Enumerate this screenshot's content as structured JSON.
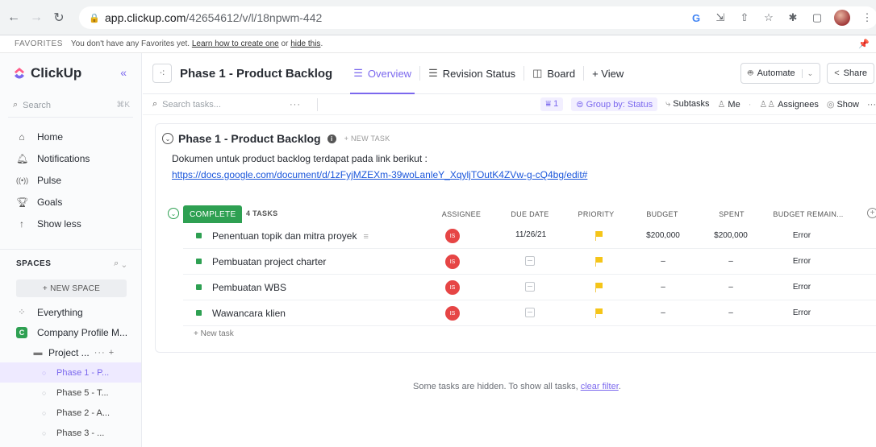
{
  "browser": {
    "url_host": "app.clickup.com",
    "url_path": "/42654612/v/l/18npwm-442"
  },
  "favorites": {
    "title": "FAVORITES",
    "message": "You don't have any Favorites yet.",
    "learn_link": "Learn how to create one",
    "or": "or",
    "hide_link": "hide this",
    "period": "."
  },
  "sidebar": {
    "brand": "ClickUp",
    "search_placeholder": "Search",
    "search_shortcut": "⌘K",
    "menu": [
      {
        "label": "Home"
      },
      {
        "label": "Notifications"
      },
      {
        "label": "Pulse"
      },
      {
        "label": "Goals"
      },
      {
        "label": "Show less"
      }
    ],
    "spaces_title": "SPACES",
    "new_space": "+ NEW SPACE",
    "everything": "Everything",
    "space_badge": "C",
    "space_name": "Company Profile M...",
    "folder_name": "Project ...",
    "lists": [
      {
        "label": "Phase 1 - P..."
      },
      {
        "label": "Phase 5 - T..."
      },
      {
        "label": "Phase 2 - A..."
      },
      {
        "label": "Phase 3 - ..."
      }
    ]
  },
  "header": {
    "title": "Phase 1 - Product Backlog",
    "tabs": [
      {
        "label": "Overview"
      },
      {
        "label": "Revision Status"
      },
      {
        "label": "Board"
      },
      {
        "label": "+ View"
      }
    ],
    "automate": "Automate",
    "share": "Share"
  },
  "toolbar": {
    "search_placeholder": "Search tasks...",
    "filter_count": "1",
    "group_by": "Group by: Status",
    "subtasks": "Subtasks",
    "me": "Me",
    "assignees": "Assignees",
    "show": "Show"
  },
  "list": {
    "title": "Phase 1 - Product Backlog",
    "new_task_top": "+ NEW TASK",
    "description": "Dokumen untuk product backlog terdapat pada link berikut :",
    "link": "https://docs.google.com/document/d/1zFyjMZEXm-39woLanleY_XqyljTOutK4ZVw-g-cQ4bg/edit#",
    "status": "COMPLETE",
    "task_count": "4 TASKS",
    "columns": {
      "assignee": "ASSIGNEE",
      "due_date": "DUE DATE",
      "priority": "PRIORITY",
      "budget": "BUDGET",
      "spent": "SPENT",
      "budget_remaining": "BUDGET REMAIN..."
    },
    "tasks": [
      {
        "name": "Penentuan topik dan mitra proyek",
        "assignee": "IS",
        "due": "11/26/21",
        "budget": "$200,000",
        "spent": "$200,000",
        "remaining": "Error"
      },
      {
        "name": "Pembuatan project charter",
        "assignee": "IS",
        "due": "",
        "budget": "–",
        "spent": "–",
        "remaining": "Error"
      },
      {
        "name": "Pembuatan WBS",
        "assignee": "IS",
        "due": "",
        "budget": "–",
        "spent": "–",
        "remaining": "Error"
      },
      {
        "name": "Wawancara klien",
        "assignee": "IS",
        "due": "",
        "budget": "–",
        "spent": "–",
        "remaining": "Error"
      }
    ],
    "new_task_row": "+ New task"
  },
  "hidden": {
    "message": "Some tasks are hidden. To show all tasks,",
    "link": "clear filter",
    "period": "."
  }
}
